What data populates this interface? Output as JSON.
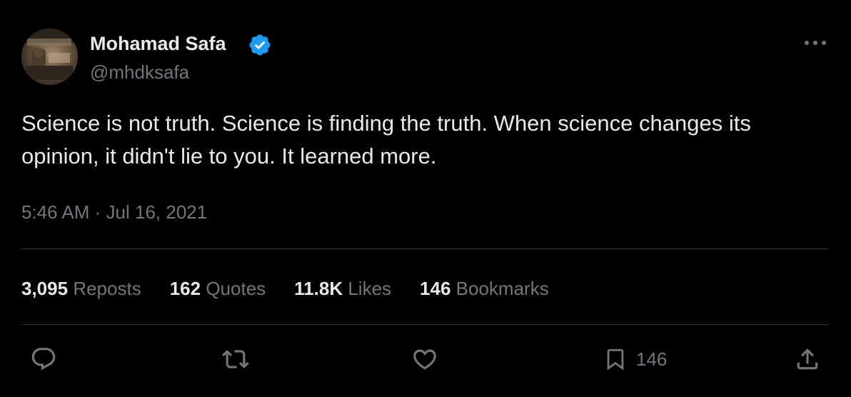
{
  "author": {
    "display_name": "Mohamad Safa",
    "handle": "@mhdksafa",
    "verified": true,
    "verified_color": "#1d9bf0"
  },
  "tweet": {
    "text": "Science is not truth. Science is finding the truth. When science changes its opinion, it didn't lie to you. It learned more.",
    "time": "5:46 AM",
    "separator": "·",
    "date": "Jul 16, 2021"
  },
  "stats": {
    "reposts": {
      "count": "3,095",
      "label": "Reposts"
    },
    "quotes": {
      "count": "162",
      "label": "Quotes"
    },
    "likes": {
      "count": "11.8K",
      "label": "Likes"
    },
    "bookmarks": {
      "count": "146",
      "label": "Bookmarks"
    }
  },
  "actions": {
    "reply_icon": "reply-icon",
    "repost_icon": "repost-icon",
    "like_icon": "heart-icon",
    "bookmark_icon": "bookmark-icon",
    "bookmark_count": "146",
    "share_icon": "share-icon"
  },
  "colors": {
    "background": "#000000",
    "primary_text": "#e7e9ea",
    "secondary_text": "#71767b",
    "divider": "#2f3336"
  }
}
